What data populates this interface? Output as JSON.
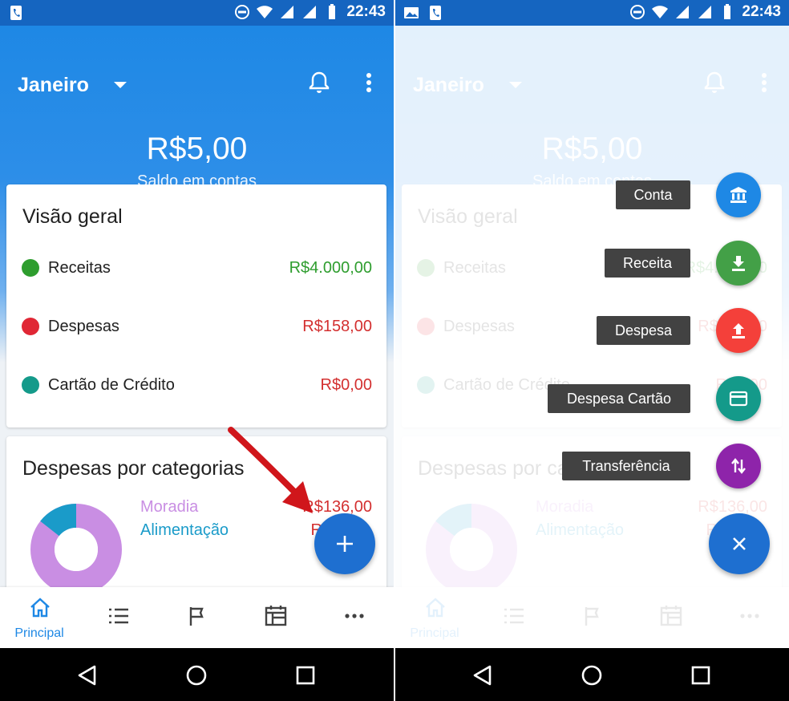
{
  "status_bar": {
    "time": "22:43"
  },
  "header": {
    "month": "Janeiro",
    "balance": "R$5,00",
    "balance_label": "Saldo em contas"
  },
  "overview": {
    "title": "Visão geral",
    "rows": [
      {
        "label": "Receitas",
        "value": "R$4.000,00",
        "dot_color": "#2e9d2e",
        "value_color": "#2e9d2e"
      },
      {
        "label": "Despesas",
        "value": "R$158,00",
        "dot_color": "#e02735",
        "value_color": "#d32f2f"
      },
      {
        "label": "Cartão de Crédito",
        "value": "R$0,00",
        "dot_color": "#149a8a",
        "value_color": "#d32f2f"
      }
    ]
  },
  "categories": {
    "title": "Despesas por categorias",
    "items": [
      {
        "label": "Moradia",
        "value": "R$136,00",
        "color": "#c98ee3",
        "share": 0.86
      },
      {
        "label": "Alimentação",
        "value": "R",
        "color": "#1a9bc9",
        "share": 0.14
      }
    ],
    "value_color": "#d32f2f"
  },
  "bottom_nav": {
    "active_label": "Principal",
    "items": [
      "home-icon",
      "list-icon",
      "flag-icon",
      "calendar-icon",
      "more-icon"
    ]
  },
  "speed_dial": [
    {
      "label": "Conta",
      "icon": "bank-icon",
      "color": "#1e88e5"
    },
    {
      "label": "Receita",
      "icon": "download-icon",
      "color": "#43a047"
    },
    {
      "label": "Despesa",
      "icon": "upload-icon",
      "color": "#f4403a"
    },
    {
      "label": "Despesa Cartão",
      "icon": "credit-card-icon",
      "color": "#149a8a"
    },
    {
      "label": "Transferência",
      "icon": "transfer-icon",
      "color": "#8e24aa"
    }
  ],
  "colors": {
    "primary": "#1e88e5",
    "status_bar": "#1565c0",
    "fab": "#1e6fd0"
  }
}
